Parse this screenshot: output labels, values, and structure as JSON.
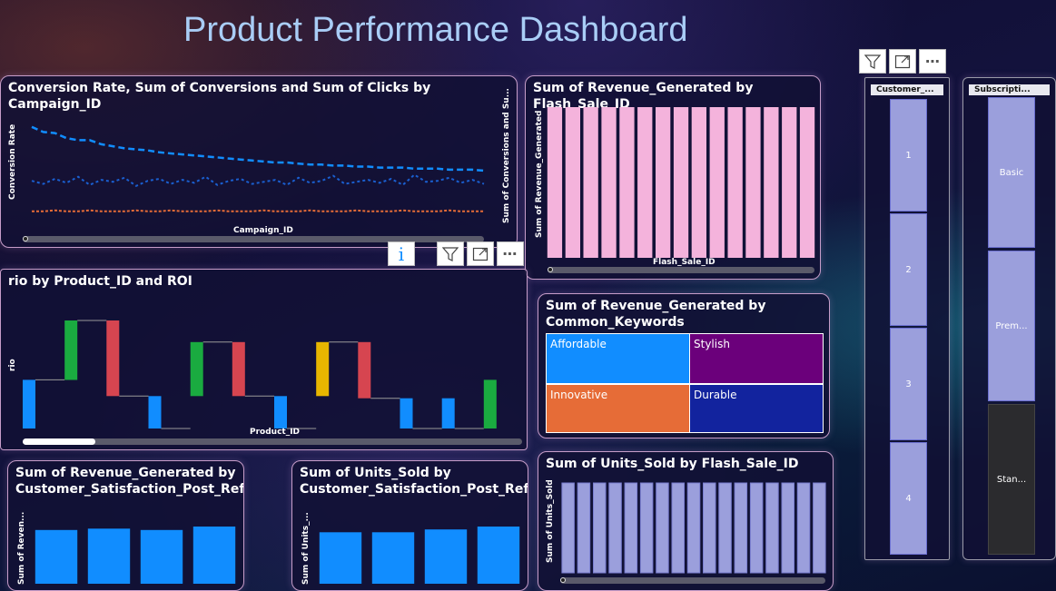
{
  "page_title": "Product Performance Dashboard",
  "colors": {
    "title": "#a9cdf6",
    "card_border": "#c79dc9",
    "blue_bar": "#118dff",
    "pink_bar": "#f4b3dc",
    "lavender_bar": "#9b9fdc",
    "orange_line": "#e66c37",
    "green": "#1aab40",
    "red": "#d64550",
    "yellow": "#e8b600"
  },
  "visual_toolbar": {
    "info_icon": "i",
    "filter_icon": "filter-icon",
    "focus_icon": "focus-mode-icon",
    "more_icon": "more-options-icon"
  },
  "charts": {
    "conversion": {
      "title": "Conversion Rate, Sum of Conversions and Sum of Clicks by Campaign_ID",
      "ylabel_left": "Conversion Rate",
      "ylabel_right": "Sum of Conversions and Su...",
      "xlabel": "Campaign_ID"
    },
    "flash_revenue": {
      "title": "Sum of Revenue_Generated by Flash_Sale_ID",
      "ylabel": "Sum of Revenue_Generated",
      "xlabel": "Flash_Sale_ID"
    },
    "ratio": {
      "title": "rio by Product_ID and ROI",
      "ylabel": "rio",
      "xlabel": "Product_ID"
    },
    "keywords": {
      "title": "Sum of Revenue_Generated by Common_Keywords",
      "cells": [
        "Affordable",
        "Stylish",
        "Innovative",
        "Durable"
      ]
    },
    "units_flash": {
      "title": "Sum of Units_Sold by Flash_Sale_ID",
      "ylabel": "Sum of Units_Sold"
    },
    "rev_satisfaction": {
      "title": "Sum of Revenue_Generated by Customer_Satisfaction_Post_Refund",
      "ylabel": "Sum of Reven..."
    },
    "units_satisfaction": {
      "title": "Sum of Units_Sold by Customer_Satisfaction_Post_Refund",
      "ylabel": "Sum of Units_..."
    }
  },
  "slicers": {
    "customer": {
      "header": "Customer_...",
      "items": [
        "1",
        "2",
        "3",
        "4"
      ]
    },
    "subscription": {
      "header": "Subscripti...",
      "items": [
        "Basic",
        "Prem...",
        "Stan..."
      ]
    }
  },
  "chart_data": [
    {
      "type": "line",
      "title": "Conversion Rate, Sum of Conversions and Sum of Clicks by Campaign_ID",
      "xlabel": "Campaign_ID",
      "ylabel": "Conversion Rate",
      "series": [
        {
          "values": [
            0.93,
            0.88,
            0.87,
            0.82,
            0.8,
            0.8,
            0.76,
            0.74,
            0.72,
            0.71,
            0.7,
            0.68,
            0.67,
            0.66,
            0.65,
            0.64,
            0.63,
            0.62,
            0.61,
            0.6,
            0.59,
            0.58,
            0.58,
            0.57,
            0.56,
            0.56,
            0.55,
            0.55,
            0.54,
            0.54,
            0.53,
            0.53,
            0.53,
            0.52,
            0.52,
            0.52,
            0.51,
            0.51,
            0.51,
            0.5
          ]
        },
        {
          "values": [
            0.4,
            0.37,
            0.42,
            0.38,
            0.44,
            0.36,
            0.41,
            0.39,
            0.43,
            0.35,
            0.4,
            0.42,
            0.37,
            0.41,
            0.38,
            0.44,
            0.36,
            0.4,
            0.42,
            0.37,
            0.39,
            0.41,
            0.36,
            0.43,
            0.38,
            0.4,
            0.45,
            0.37,
            0.39,
            0.41,
            0.38,
            0.42,
            0.36,
            0.46,
            0.39,
            0.4,
            0.43,
            0.38,
            0.41,
            0.37
          ]
        },
        {
          "values": [
            0.1,
            0.1,
            0.11,
            0.1,
            0.1,
            0.11,
            0.1,
            0.1,
            0.1,
            0.11,
            0.1,
            0.1,
            0.11,
            0.1,
            0.1,
            0.1,
            0.11,
            0.1,
            0.1,
            0.1,
            0.11,
            0.1,
            0.1,
            0.1,
            0.11,
            0.1,
            0.1,
            0.1,
            0.11,
            0.1,
            0.1,
            0.1,
            0.11,
            0.1,
            0.1,
            0.1,
            0.11,
            0.1,
            0.1,
            0.1
          ]
        }
      ]
    },
    {
      "type": "bar",
      "title": "Sum of Revenue_Generated by Flash_Sale_ID",
      "xlabel": "Flash_Sale_ID",
      "ylabel": "Sum of Revenue_Generated",
      "values": [
        1,
        1,
        1,
        1,
        1,
        1,
        1,
        1,
        1,
        1,
        1,
        1,
        1,
        1,
        1
      ]
    },
    {
      "type": "bar",
      "title": "rio by Product_ID and ROI",
      "xlabel": "Product_ID",
      "ylabel": "rio",
      "waterfall": [
        {
          "base": 0,
          "delta": 0.45,
          "color": "blue"
        },
        {
          "base": 0.45,
          "delta": 0.55,
          "color": "green"
        },
        {
          "base": 1.0,
          "delta": -0.7,
          "color": "red"
        },
        {
          "base": 0.3,
          "delta": -0.3,
          "color": "blue"
        },
        {
          "base": 0.3,
          "delta": 0.5,
          "color": "green"
        },
        {
          "base": 0.8,
          "delta": -0.5,
          "color": "red"
        },
        {
          "base": 0.3,
          "delta": -0.3,
          "color": "blue"
        },
        {
          "base": 0.3,
          "delta": 0.5,
          "color": "yellow"
        },
        {
          "base": 0.8,
          "delta": -0.52,
          "color": "red"
        },
        {
          "base": 0.28,
          "delta": -0.28,
          "color": "blue"
        },
        {
          "base": 0.28,
          "delta": -0.28,
          "color": "blue"
        },
        {
          "base": 0.0,
          "delta": 0.45,
          "color": "green"
        }
      ]
    },
    {
      "type": "heatmap",
      "title": "Sum of Revenue_Generated by Common_Keywords",
      "categories": [
        "Affordable",
        "Stylish",
        "Innovative",
        "Durable"
      ],
      "values": [
        30,
        28,
        26,
        25
      ]
    },
    {
      "type": "bar",
      "title": "Sum of Units_Sold by Flash_Sale_ID",
      "ylabel": "Sum of Units_Sold",
      "values": [
        1,
        1,
        1,
        1,
        1,
        1,
        1,
        1,
        1,
        1,
        1,
        1,
        1,
        1,
        1,
        1,
        1
      ]
    },
    {
      "type": "bar",
      "title": "Sum of Revenue_Generated by Customer_Satisfaction_Post_Refund",
      "ylabel": "Sum of Reven...",
      "values": [
        0.78,
        0.8,
        0.78,
        0.83
      ]
    },
    {
      "type": "bar",
      "title": "Sum of Units_Sold by Customer_Satisfaction_Post_Refund",
      "ylabel": "Sum of Units_...",
      "values": [
        0.9,
        0.9,
        0.95,
        1.0
      ]
    }
  ]
}
